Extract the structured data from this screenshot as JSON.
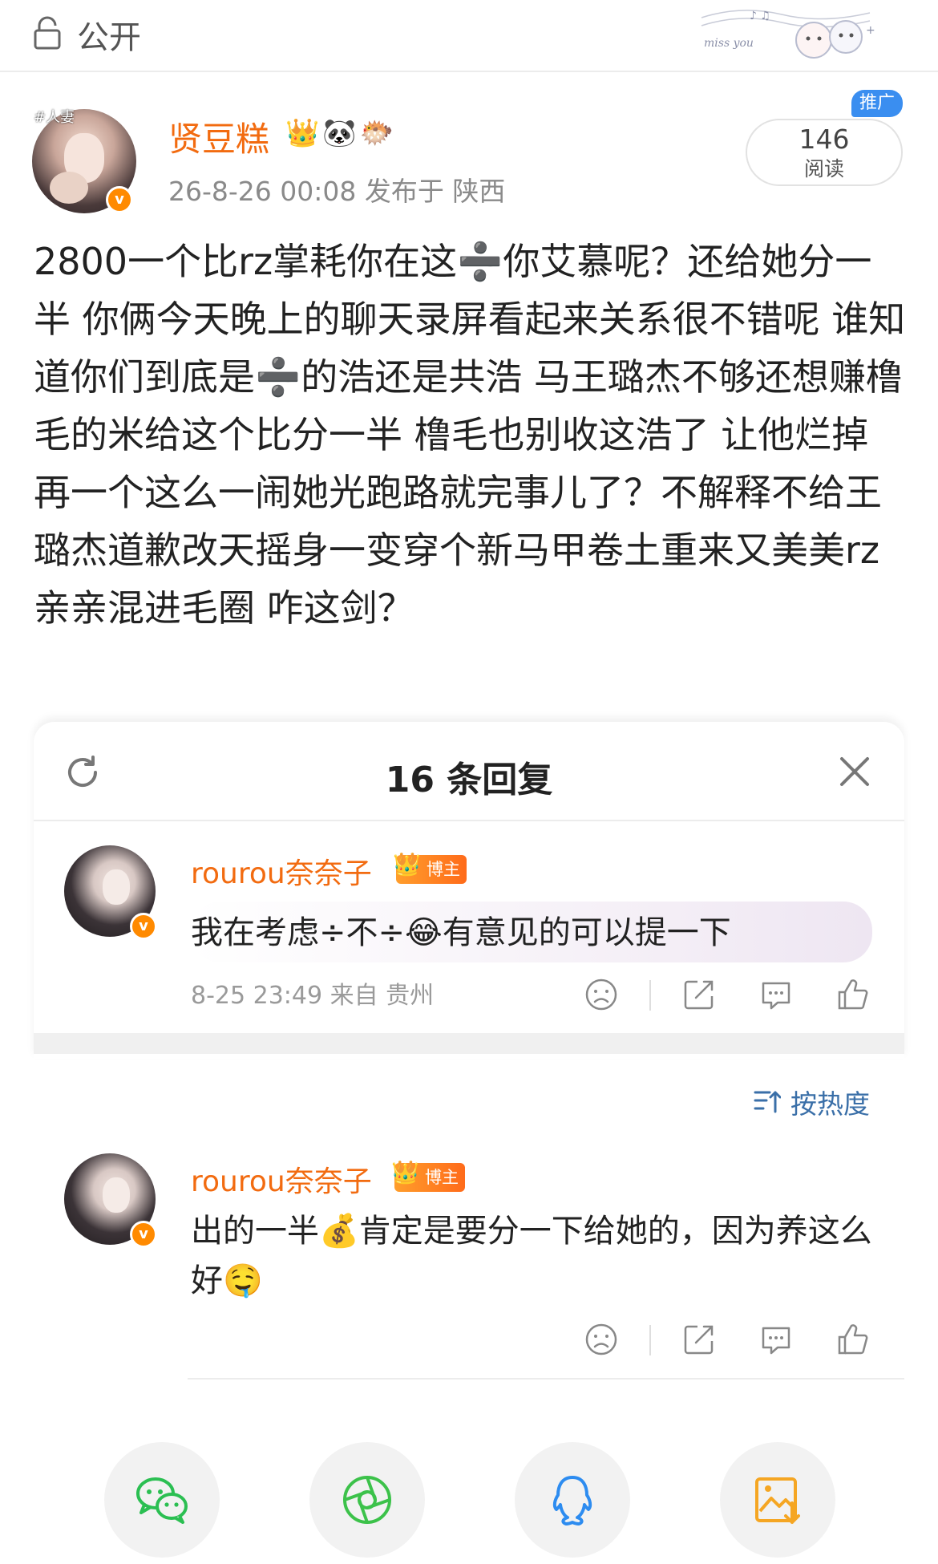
{
  "topbar": {
    "visibility_label": "公开",
    "decoration_text": "miss you"
  },
  "post": {
    "avatar_tag": "#人妻",
    "author_name": "贤豆糕",
    "author_badges": "👑🐼🐡",
    "meta": "26-8-26 00:08  发布于 陕西",
    "read_count": "146",
    "read_label": "阅读",
    "promo_tag": "推广",
    "body": "2800一个比rz掌耗你在这➗你艾慕呢？还给她分一半 你俩今天晚上的聊天录屏看起来关系很不错呢 谁知道你们到底是➗的浩还是共浩 马王璐杰不够还想赚橹毛的米给这个比分一半 橹毛也别收这浩了 让他烂掉 再一个这么一闹她光跑路就完事儿了？不解释不给王璐杰道歉改天摇身一变穿个新马甲卷土重来又美美rz亲亲混进毛圈 咋这剑？"
  },
  "panel": {
    "title": "16 条回复",
    "replies": [
      {
        "name": "rourou奈奈子",
        "badge": "博主",
        "text": "我在考虑÷不÷😂有意见的可以提一下",
        "meta": "8-25 23:49  来自 贵州"
      },
      {
        "name": "rourou奈奈子",
        "badge": "博主",
        "text": "出的一半💰肯定是要分一下给她的，因为养这么好🤤",
        "meta": ""
      }
    ],
    "sort_label": "按热度"
  },
  "colors": {
    "accent_orange": "#f26b10",
    "link_blue": "#3a6fa8",
    "wechat_green": "#2bbf52",
    "moments_green": "#3cc24a",
    "qq_blue": "#2d8cf0",
    "save_orange": "#f5a623"
  },
  "icons": [
    "lock-icon",
    "refresh-icon",
    "close-icon",
    "dislike-icon",
    "share-icon",
    "comment-icon",
    "like-icon",
    "sort-icon",
    "wechat-icon",
    "moments-icon",
    "qq-icon",
    "save-image-icon"
  ]
}
